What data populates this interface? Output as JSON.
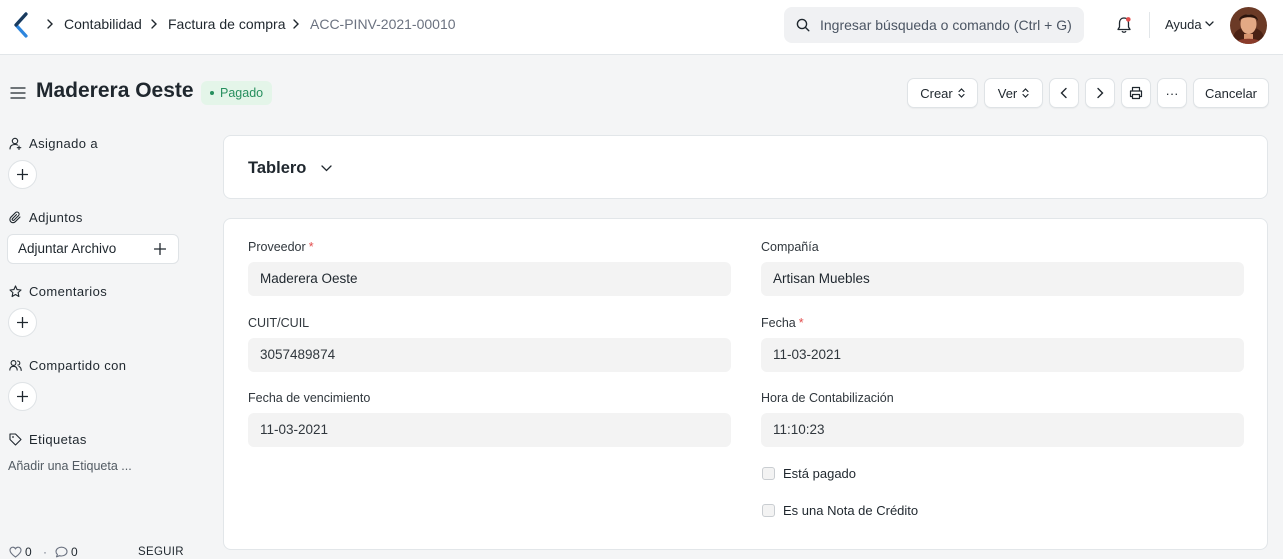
{
  "breadcrumbs": [
    "Contabilidad",
    "Factura de compra",
    "ACC-PINV-2021-00010"
  ],
  "search": {
    "placeholder": "Ingresar búsqueda o comando (Ctrl + G)"
  },
  "navbar": {
    "help_label": "Ayuda"
  },
  "page": {
    "title": "Maderera Oeste",
    "status": "Pagado",
    "status_color": "#278f5e"
  },
  "actions": {
    "create": "Crear",
    "view": "Ver",
    "more": "···",
    "cancel": "Cancelar"
  },
  "sidebar": {
    "assigned_to": "Asignado a",
    "attachments": "Adjuntos",
    "attach_file": "Adjuntar Archivo",
    "comments": "Comentarios",
    "shared_with": "Compartido con",
    "tags": "Etiquetas",
    "add_tag": "Añadir una Etiqueta ...",
    "likes": "0",
    "comment_count": "0",
    "separator": "·",
    "follow": "SEGUIR"
  },
  "dashboard": {
    "title": "Tablero"
  },
  "form": {
    "supplier": {
      "label": "Proveedor",
      "value": "Maderera Oeste",
      "required": "*"
    },
    "company": {
      "label": "Compañía",
      "value": "Artisan Muebles"
    },
    "tax_id": {
      "label": "CUIT/CUIL",
      "value": "3057489874"
    },
    "date": {
      "label": "Fecha",
      "value": "11-03-2021",
      "required": "*"
    },
    "due_date": {
      "label": "Fecha de vencimiento",
      "value": "11-03-2021"
    },
    "posting_time": {
      "label": "Hora de Contabilización",
      "value": "11:10:23"
    },
    "is_paid": {
      "label": "Está pagado",
      "checked": false
    },
    "is_return": {
      "label": "Es una Nota de Crédito",
      "checked": false
    }
  }
}
